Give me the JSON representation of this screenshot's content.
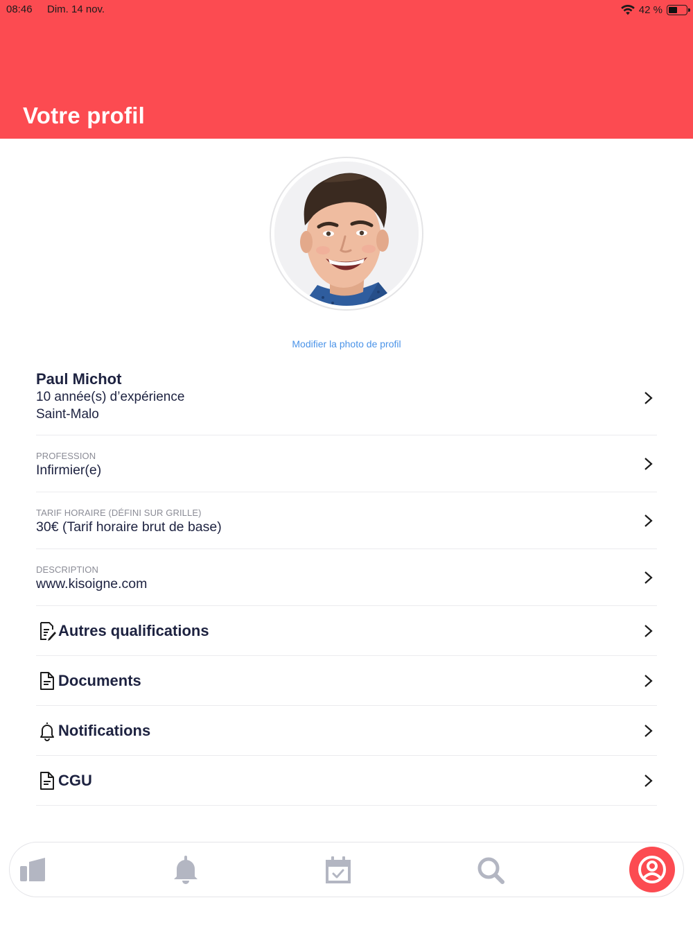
{
  "status_bar": {
    "time": "08:46",
    "date": "Dim. 14 nov.",
    "battery_text": "42 %",
    "battery_level": 0.42
  },
  "header": {
    "title": "Votre profil",
    "color": "#fc4b51"
  },
  "profile": {
    "change_photo_label": "Modifier la photo de profil",
    "name": "Paul Michot",
    "experience": "10 année(s) d’expérience",
    "city": "Saint-Malo"
  },
  "fields": [
    {
      "label": "PROFESSION",
      "value": "Infirmier(e)"
    },
    {
      "label": "TARIF HORAIRE (DÉFINI SUR GRILLE)",
      "value": "30€ (Tarif horaire brut de base)"
    },
    {
      "label": "DESCRIPTION",
      "value": "www.kisoigne.com"
    }
  ],
  "menu": [
    {
      "label": "Autres qualifications",
      "icon": "edit-document-icon"
    },
    {
      "label": "Documents",
      "icon": "document-icon"
    },
    {
      "label": "Notifications",
      "icon": "bell-icon"
    },
    {
      "label": "CGU",
      "icon": "document-icon"
    }
  ],
  "tabbar": {
    "tabs": [
      {
        "icon": "dashboard-icon"
      },
      {
        "icon": "bell-icon"
      },
      {
        "icon": "calendar-check-icon"
      },
      {
        "icon": "search-icon"
      },
      {
        "icon": "profile-icon",
        "active": true
      }
    ],
    "inactive_color": "#b3b6c2",
    "active_color": "#fc4b51"
  }
}
